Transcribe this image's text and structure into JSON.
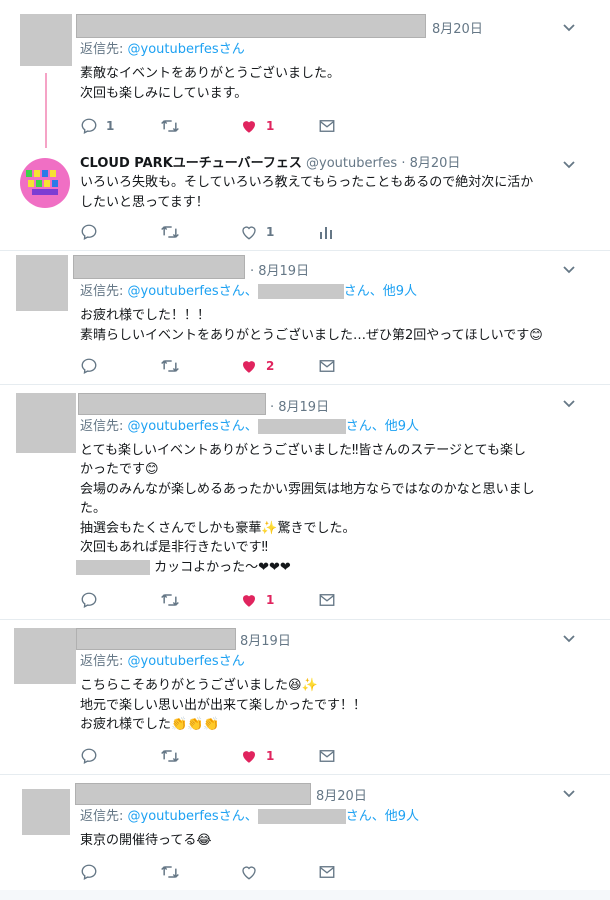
{
  "tweets": [
    {
      "date": "8月20日",
      "reply_prefix": "返信先: ",
      "reply_handle": "@youtuberfes",
      "reply_suffix": "さん",
      "lines": [
        "素敵なイベントをありがとうございました。",
        "次回も楽しみにしています。"
      ],
      "actions": {
        "reply_count": "1",
        "retweet_count": "",
        "like_count": "1"
      }
    },
    {
      "display_name": "CLOUD PARKユーチューバーフェス",
      "handle": "@youtuberfes",
      "sep": "·",
      "date": "8月20日",
      "lines": [
        "いろいろ失敗も。そしていろいろ教えてもらったこともあるので絶対次に活か",
        "したいと思ってます！"
      ],
      "actions": {
        "reply_count": "",
        "retweet_count": "",
        "like_count": "1"
      }
    },
    {
      "date": "8月19日",
      "reply_prefix": "返信先: ",
      "reply_handle": "@youtuberfes",
      "reply_suffix": "さん、",
      "reply_more": "さん、他9人",
      "lines": [
        "お疲れ様でした！！！",
        "素晴らしいイベントをありがとうございました…ぜひ第2回やってほしいです😊"
      ],
      "actions": {
        "reply_count": "",
        "retweet_count": "",
        "like_count": "2"
      }
    },
    {
      "date": "8月19日",
      "reply_prefix": "返信先: ",
      "reply_handle": "@youtuberfes",
      "reply_suffix": "さん、",
      "reply_more": "さん、他9人",
      "lines": [
        "とても楽しいイベントありがとうございました‼皆さんのステージとても楽し",
        "かったです😊",
        "会場のみんなが楽しめるあったかい雰囲気は地方ならではなのかなと思いまし",
        "た。",
        "抽選会もたくさんでしかも豪華✨驚きでした。",
        "次回もあれば是非行きたいです‼"
      ],
      "last_line": "カッコよかった〜❤❤❤",
      "actions": {
        "reply_count": "",
        "retweet_count": "",
        "like_count": "1"
      }
    },
    {
      "date": "8月19日",
      "reply_prefix": "返信先: ",
      "reply_handle": "@youtuberfes",
      "reply_suffix": "さん",
      "lines": [
        "こちらこそありがとうございました😆✨",
        "地元で楽しい思い出が出来て楽しかったです！！",
        "お疲れ様でした👏👏👏"
      ],
      "actions": {
        "reply_count": "",
        "retweet_count": "",
        "like_count": "1"
      }
    },
    {
      "date": "8月20日",
      "reply_prefix": "返信先: ",
      "reply_handle": "@youtuberfes",
      "reply_suffix": "さん、",
      "reply_more": "さん、他9人",
      "lines": [
        "東京の開催待ってる😂"
      ],
      "actions": {
        "reply_count": "",
        "retweet_count": "",
        "like_count": ""
      }
    }
  ],
  "colors": {
    "like": "#e0245e",
    "link": "#1da1f2",
    "muted": "#657786",
    "thread": "#f5a3c6"
  },
  "icons": [
    "reply-icon",
    "retweet-icon",
    "heart-icon",
    "mail-icon",
    "analytics-icon",
    "chevron-down-icon"
  ]
}
